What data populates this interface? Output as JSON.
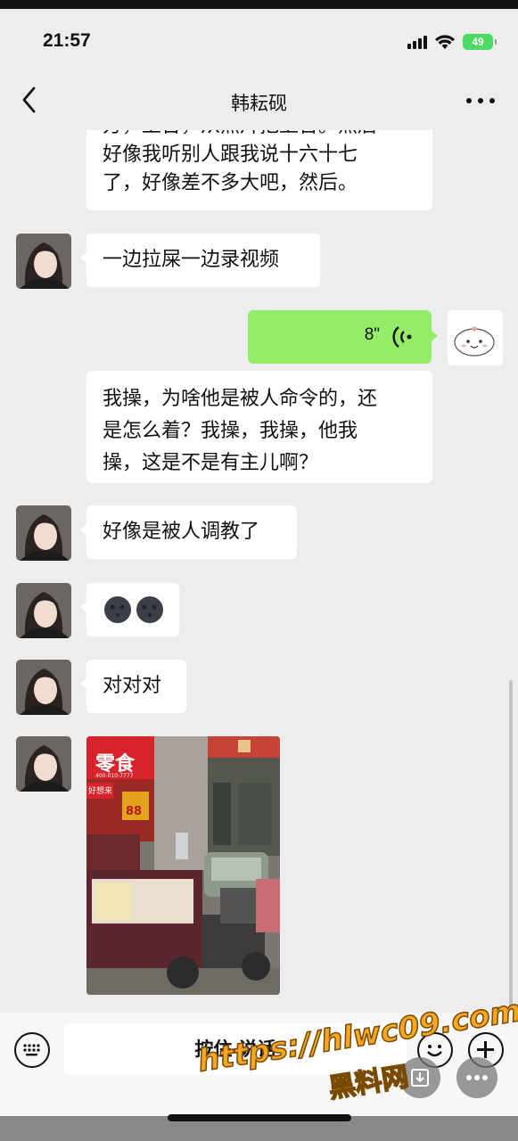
{
  "status": {
    "time": "21:57",
    "battery": "49"
  },
  "nav": {
    "title": "韩耘砚"
  },
  "messages": {
    "m1_partial": "方，上台，从照片把上台。然后",
    "m1_line2": "好像我听别人跟我说十六十七",
    "m1_line3": "了，好像差不多大吧，然后。",
    "m2": "一边拉屎一边录视频",
    "voice_duration": "8\"",
    "m3_line1": "我操，为啥他是被人命令的，还",
    "m3_line2": "是怎么着？我操，我操，他我",
    "m3_line3": "操，这是不是有主儿啊？",
    "m4": "好像是被人调教了",
    "m5": "🌚🌚",
    "m6": "对对对",
    "photo_signs": {
      "sign1": "零食",
      "sign2": "400-010-7777",
      "sign3": "好想来",
      "sign4": "88"
    }
  },
  "input": {
    "hold_label": "按住 说话"
  },
  "watermark": {
    "url": "https://hlwc09.com",
    "site": "黑料网"
  },
  "colors": {
    "bg": "#ededed",
    "voice_bubble": "#95ec69",
    "watermark": "#f5a623"
  }
}
